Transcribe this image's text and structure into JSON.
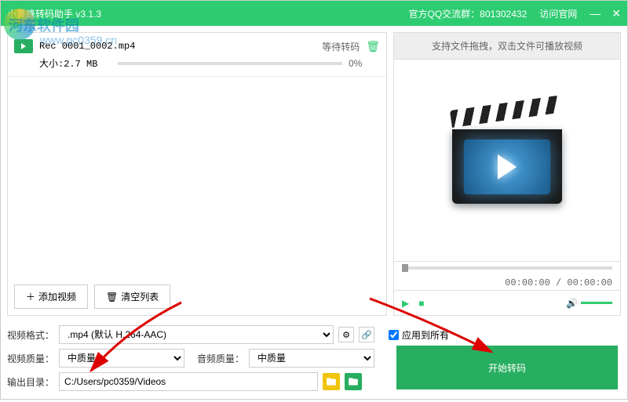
{
  "header": {
    "title": "小黄蜂转码助手 v3.1.3",
    "qq_label": "官方QQ交流群：801302432",
    "website_label": "访问官网"
  },
  "file": {
    "name": "Rec 0001_0002.mp4",
    "status": "等待转码",
    "size_label": "大小:2.7 MB",
    "progress_pct": "0%"
  },
  "left_buttons": {
    "add_video": "添加视频",
    "clear_list": "清空列表"
  },
  "preview": {
    "hint": "支持文件拖拽，双击文件可播放视频",
    "time": "00:00:00 / 00:00:00"
  },
  "settings": {
    "format_label": "视频格式：",
    "format_value": ".mp4 (默认 H.264-AAC)",
    "vquality_label": "视频质量：",
    "vquality_value": "中质量",
    "aquality_label": "音频质量：",
    "aquality_value": "中质量",
    "output_label": "输出目录：",
    "output_value": "C:/Users/pc0359/Videos",
    "apply_all": "应用到所有"
  },
  "start_button": "开始转码",
  "watermark": {
    "line1": "河东软件园",
    "line2": "www.pc0359.cn"
  }
}
